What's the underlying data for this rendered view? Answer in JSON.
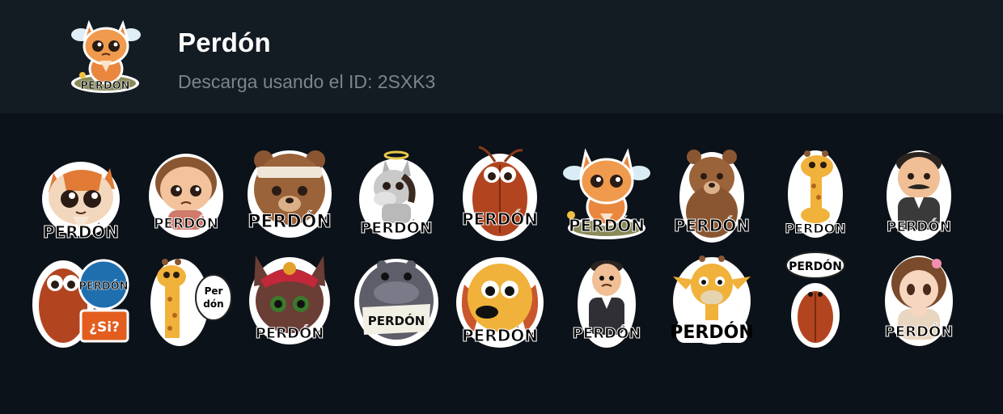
{
  "header": {
    "title": "Perdón",
    "subtitle": "Descarga usando el ID: 2SXK3",
    "thumb_caption": "PERDÓN"
  },
  "stickers": [
    {
      "caption": "PERDÓN",
      "icon": "orange-cat-praying-icon"
    },
    {
      "caption": "PERDÓN",
      "icon": "sad-boy-icon"
    },
    {
      "caption": "PERDÓN",
      "icon": "bear-with-bandage-icon"
    },
    {
      "caption": "PERDÓN",
      "icon": "donkey-with-halo-icon"
    },
    {
      "caption": "PERDÓN",
      "icon": "cockroach-icon"
    },
    {
      "caption": "PERDÓN",
      "icon": "crying-cat-praying-icon"
    },
    {
      "caption": "PERDÓN",
      "icon": "brown-bear-icon"
    },
    {
      "caption": "PERDÓN",
      "icon": "small-giraffe-icon"
    },
    {
      "caption": "PERDÓN",
      "icon": "mustache-man-praying-icon"
    },
    {
      "caption": "PERDÓN",
      "caption2": "¿Si?",
      "icon": "cockroach-with-signs-icon"
    },
    {
      "caption": "Per",
      "caption2": "dón",
      "icon": "giraffe-speech-bubble-icon"
    },
    {
      "caption": "PERDÓN",
      "icon": "cat-with-turban-icon"
    },
    {
      "caption": "PERDÓN",
      "icon": "hippo-holding-sign-icon"
    },
    {
      "caption": "PERDÓN",
      "icon": "sad-dog-icon"
    },
    {
      "caption": "PERDÓN",
      "icon": "man-in-suit-icon"
    },
    {
      "caption": "PERDÓN",
      "icon": "giraffe-head-icon"
    },
    {
      "caption": "PERDÓN",
      "icon": "cockroach-speech-bubble-icon"
    },
    {
      "caption": "PERDÓN",
      "icon": "anime-girl-praying-icon"
    }
  ]
}
